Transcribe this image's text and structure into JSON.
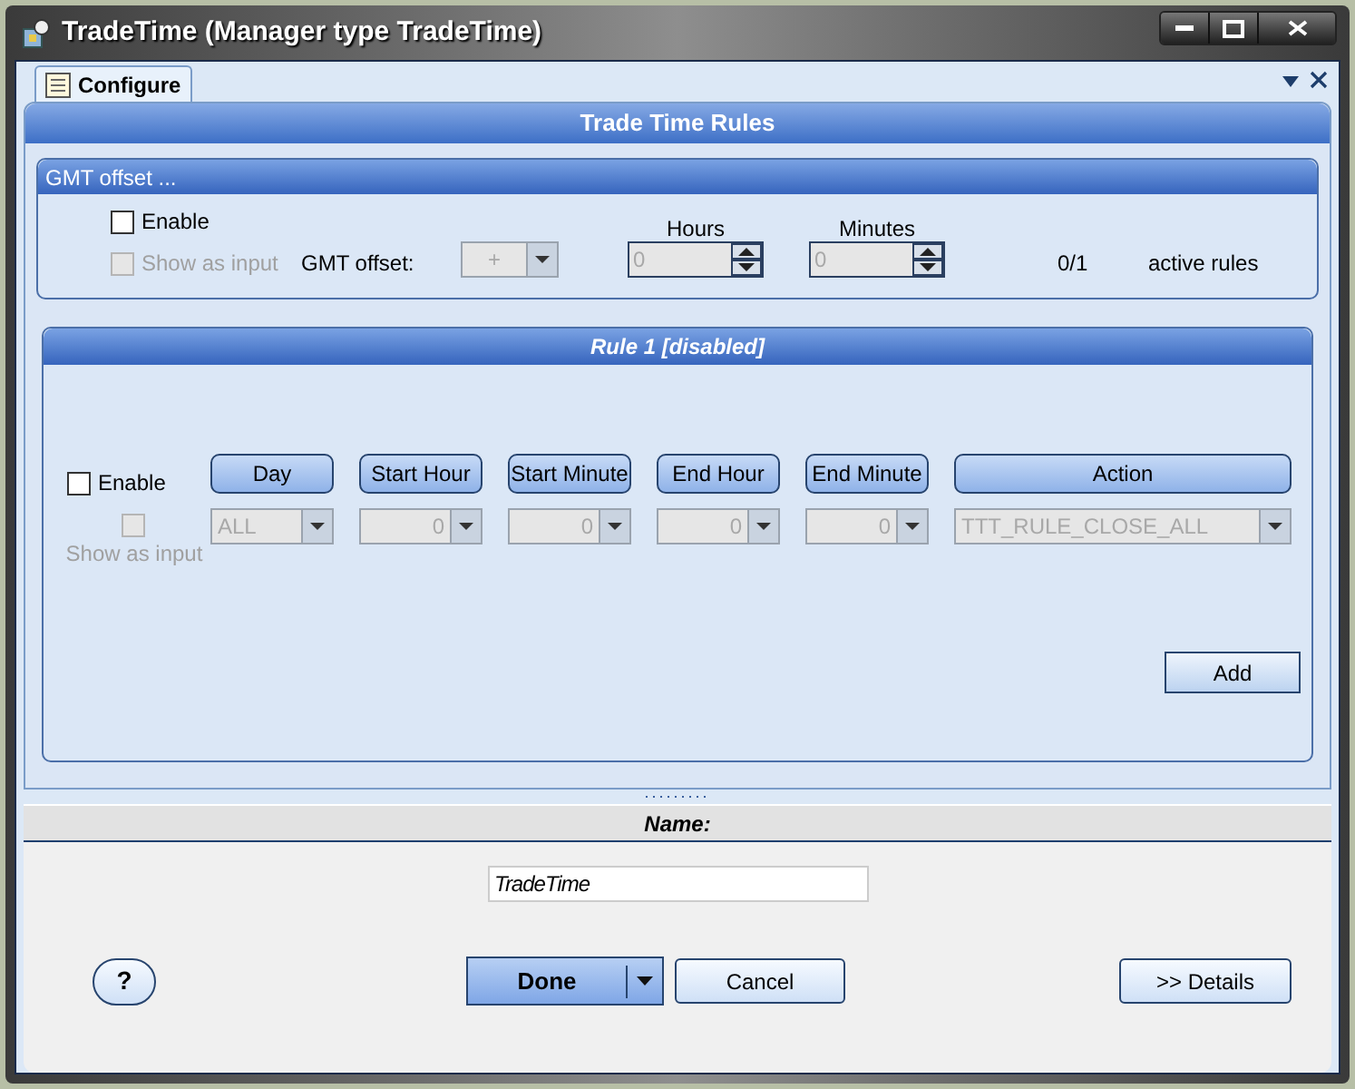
{
  "window": {
    "title": "TradeTime (Manager type TradeTime)"
  },
  "tabs": [
    {
      "label": "Configure",
      "selected": true
    }
  ],
  "panel": {
    "title": "Trade Time Rules"
  },
  "gmt_group": {
    "title": "GMT offset ...",
    "enable": {
      "label": "Enable",
      "checked": false
    },
    "show_as_input": {
      "label": "Show as input",
      "checked": false,
      "disabled": true
    },
    "offset_label": "GMT offset:",
    "sign": {
      "value": "+",
      "disabled": true
    },
    "hours": {
      "label": "Hours",
      "value": "0",
      "disabled": true
    },
    "minutes": {
      "label": "Minutes",
      "value": "0",
      "disabled": true
    },
    "count": "0/1",
    "count_label": "active rules"
  },
  "rule": {
    "title": "Rule 1 [disabled]",
    "enable": {
      "label": "Enable",
      "checked": false
    },
    "show_as_input": {
      "label": "Show as input",
      "checked": false,
      "disabled": true
    },
    "columns": [
      {
        "header": "Day",
        "value": "ALL",
        "kind": "text",
        "disabled": true
      },
      {
        "header": "Start Hour",
        "value": "0",
        "kind": "number",
        "disabled": true
      },
      {
        "header": "Start Minute",
        "value": "0",
        "kind": "number",
        "disabled": true
      },
      {
        "header": "End Hour",
        "value": "0",
        "kind": "number",
        "disabled": true
      },
      {
        "header": "End Minute",
        "value": "0",
        "kind": "number",
        "disabled": true
      },
      {
        "header": "Action",
        "value": "TTT_RULE_CLOSE_ALL",
        "kind": "text",
        "disabled": true
      }
    ],
    "add_button": "Add"
  },
  "name_section": {
    "title": "Name:",
    "value": "TradeTime"
  },
  "buttons": {
    "help": "?",
    "done": "Done",
    "cancel": "Cancel",
    "details": ">> Details"
  }
}
